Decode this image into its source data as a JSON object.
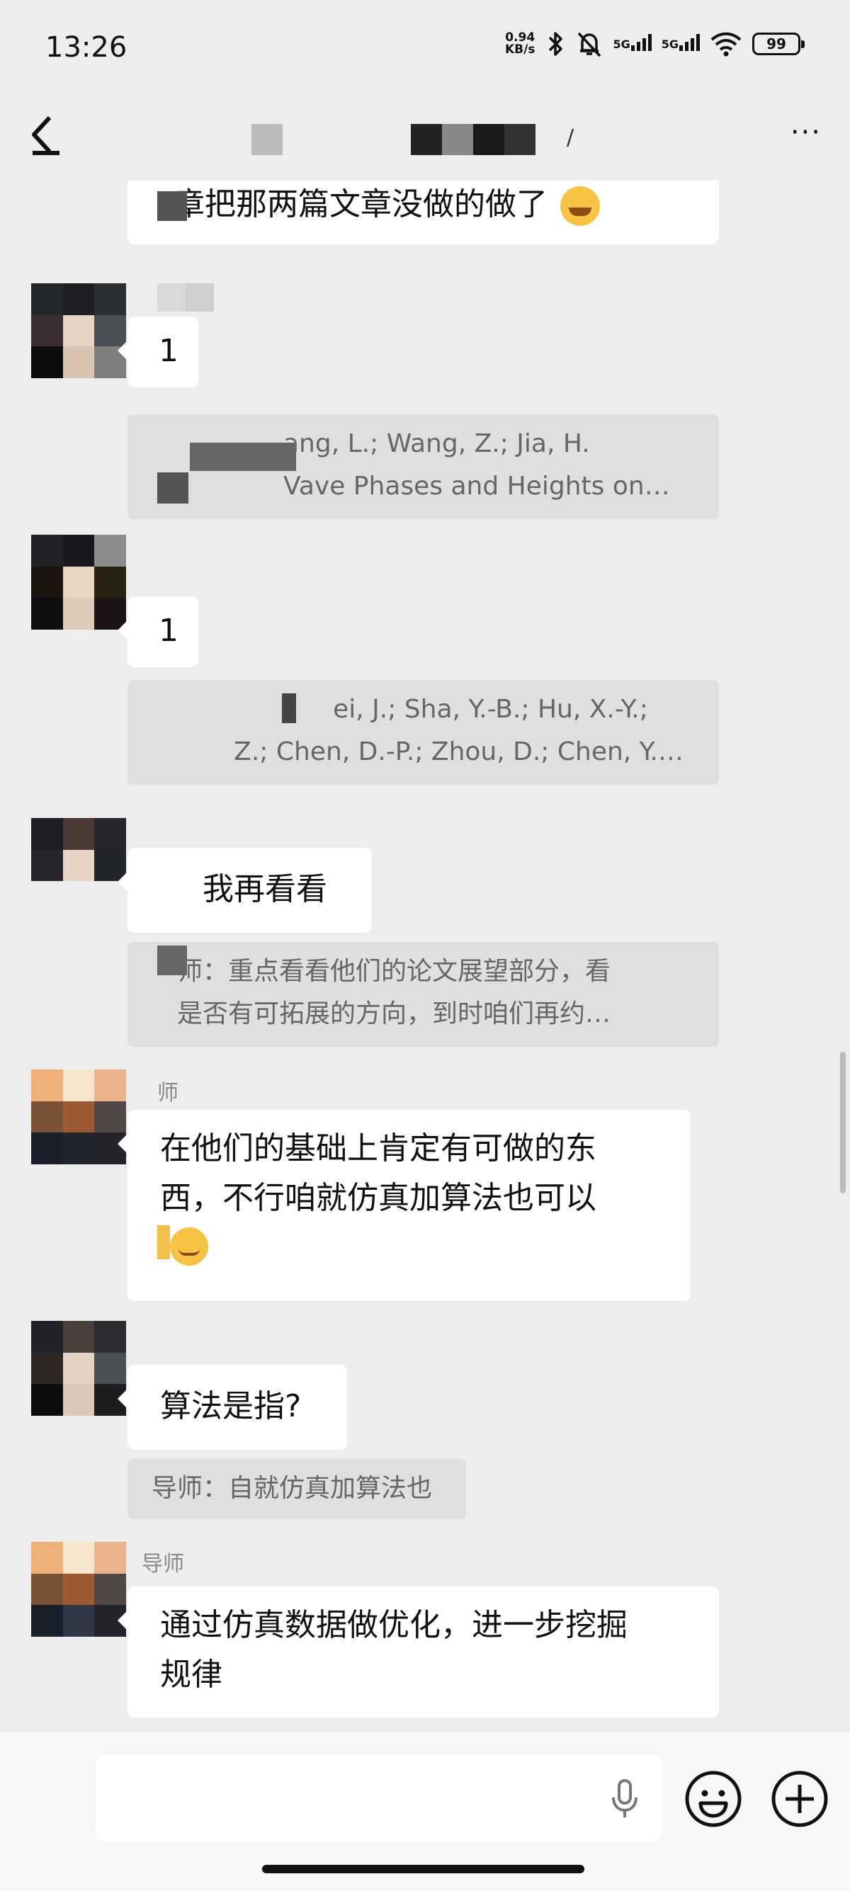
{
  "status_bar": {
    "time": "13:26",
    "net_speed_value": "0.94",
    "net_speed_unit": "KB/s",
    "signal1_label": "5G",
    "signal2_label": "5G",
    "battery": "99",
    "icons": [
      "bluetooth-icon",
      "mute-bell-icon",
      "wifi-icon"
    ]
  },
  "header": {
    "title_fragment": "/",
    "more_label": "···",
    "back_icon": "back-arrow-icon"
  },
  "messages": {
    "m0_text": "章把那两篇文章没做的做了",
    "m1_text": "1",
    "q1_line1": "ang, L.; Wang, Z.; Jia, H.",
    "q1_line2": "Vave Phases and Heights on…",
    "m2_text": "1",
    "q2_line1": "ei, J.; Sha, Y.-B.; Hu, X.-Y.;",
    "q2_line2": "Z.; Chen, D.-P.; Zhou, D.; Chen, Y.…",
    "m3_text": "我再看看",
    "q3_line1": "师：重点看看他们的论文展望部分，看",
    "q3_line2": "是否有可拓展的方向，到时咱们再约…",
    "m4_sender": "师",
    "m4_line1": "在他们的基础上肯定有可做的东",
    "m4_line2": "西，不行咱就仿真加算法也可以",
    "m5_text": "算法是指?",
    "q5_text": "导师：自就仿真加算法也",
    "m6_sender": "导师",
    "m6_line1": "通过仿真数据做优化，进一步挖掘",
    "m6_line2": "规律"
  },
  "input_bar": {
    "placeholder": "",
    "icons": [
      "microphone-icon",
      "emoji-icon",
      "plus-icon"
    ]
  },
  "colors": {
    "background": "#ededed",
    "bubble": "#ffffff",
    "quote_bg": "#dfdfdf",
    "quote_text": "#666666",
    "sender_name": "#888888"
  }
}
